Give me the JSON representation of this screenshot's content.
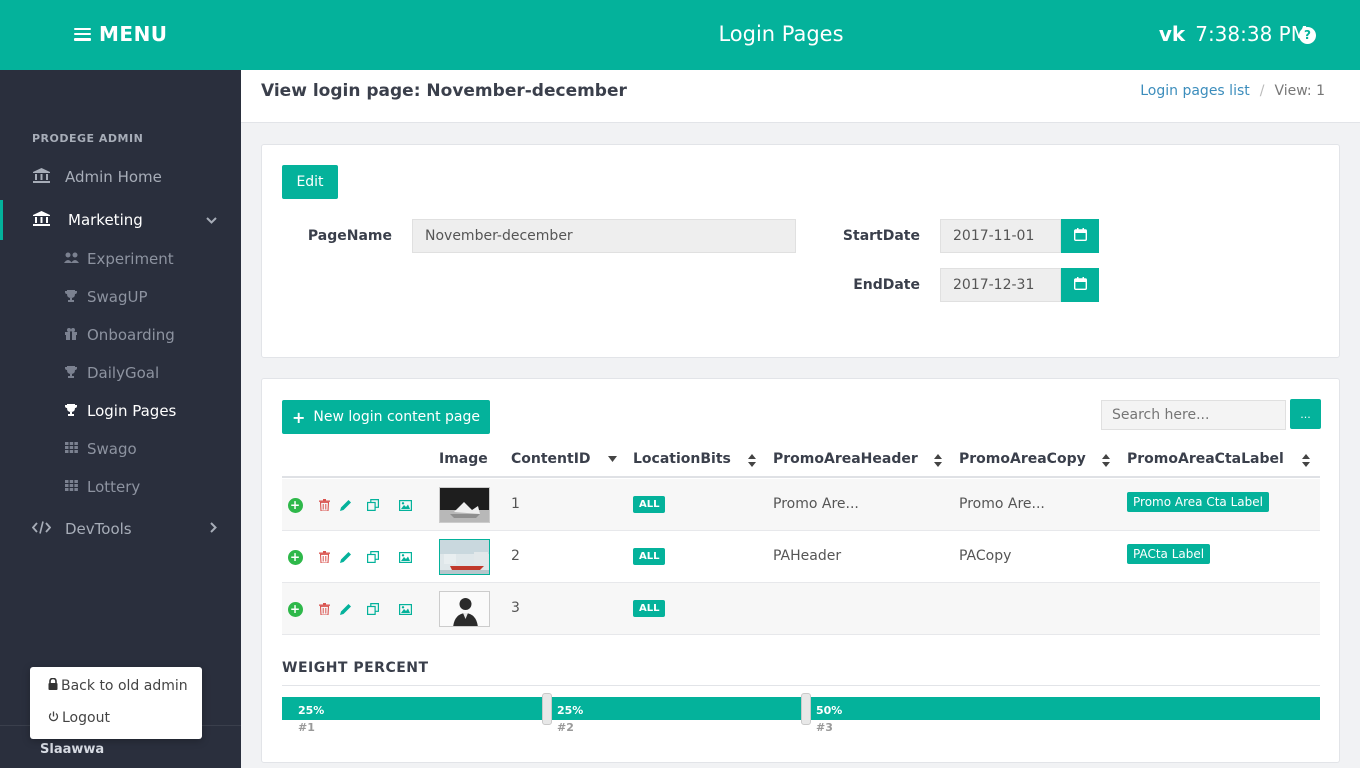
{
  "topbar": {
    "menu_label": "MENU",
    "title": "Login Pages",
    "user": "vk",
    "time": "7:38:38 PM",
    "help_glyph": "?",
    "accent_color": "#04b29b"
  },
  "sidebar": {
    "heading": "PRODEGE ADMIN",
    "items": [
      {
        "label": "Admin Home",
        "icon": "bank-icon"
      },
      {
        "label": "Marketing",
        "icon": "bank-icon",
        "expanded": true
      },
      {
        "label": "DevTools",
        "icon": "code-icon"
      }
    ],
    "sub_items": [
      {
        "label": "Experiment",
        "icon": "users-icon"
      },
      {
        "label": "SwagUP",
        "icon": "trophy-icon"
      },
      {
        "label": "Onboarding",
        "icon": "gift-icon"
      },
      {
        "label": "DailyGoal",
        "icon": "trophy-icon"
      },
      {
        "label": "Login Pages",
        "icon": "trophy-icon",
        "current": true
      },
      {
        "label": "Swago",
        "icon": "grid-icon"
      },
      {
        "label": "Lottery",
        "icon": "grid-icon"
      }
    ],
    "footer_user": "Slaawwa",
    "popup": {
      "back_label": "Back to old admin",
      "logout_label": "Logout"
    }
  },
  "header": {
    "title": "View login page: November-december",
    "breadcrumb_link": "Login pages list",
    "breadcrumb_sep": "/",
    "breadcrumb_current": "View: 1"
  },
  "form": {
    "edit_label": "Edit",
    "pagename_label": "PageName",
    "pagename_value": "November-december",
    "startdate_label": "StartDate",
    "startdate_value": "2017-11-01",
    "enddate_label": "EndDate",
    "enddate_value": "2017-12-31"
  },
  "content": {
    "new_button_label": "New login content page",
    "search_placeholder": "Search here...",
    "search_button_label": "...",
    "columns": [
      "Image",
      "ContentID",
      "LocationBits",
      "PromoAreaHeader",
      "PromoAreaCopy",
      "PromoAreaCtaLabel"
    ],
    "rows": [
      {
        "content_id": "1",
        "location": "ALL",
        "header": "Promo Are...",
        "copy": "Promo Are...",
        "cta": "Promo Area Cta Label"
      },
      {
        "content_id": "2",
        "location": "ALL",
        "header": "PAHeader",
        "copy": "PACopy",
        "cta": "PACta Label"
      },
      {
        "content_id": "3",
        "location": "ALL",
        "header": "",
        "copy": "",
        "cta": ""
      }
    ]
  },
  "weights": {
    "title": "WEIGHT PERCENT",
    "segments": [
      {
        "label": "25%",
        "num": "#1",
        "value": 25
      },
      {
        "label": "25%",
        "num": "#2",
        "value": 25
      },
      {
        "label": "50%",
        "num": "#3",
        "value": 50
      }
    ]
  }
}
